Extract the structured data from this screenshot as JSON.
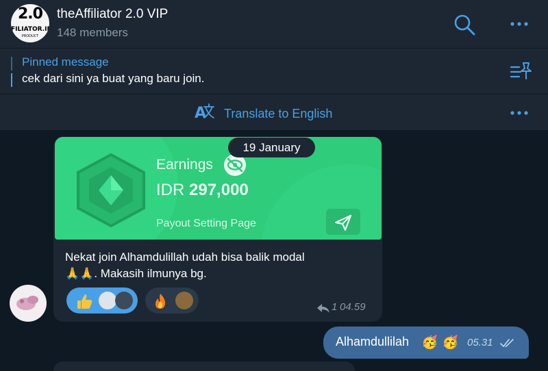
{
  "header": {
    "avatar_big": "2.0",
    "avatar_small": "FILIATOR.ID",
    "avatar_tiny": "PRODUCT",
    "title": "theAffiliator 2.0 VIP",
    "subtitle": "148 members"
  },
  "pinned": {
    "title": "Pinned message",
    "text": "cek dari sini ya buat yang baru join."
  },
  "translate": {
    "label": "Translate to English"
  },
  "message": {
    "date": "19 January",
    "card": {
      "earnings_label": "Earnings",
      "currency": "IDR",
      "amount": "297,000",
      "payout_label": "Payout Setting Page"
    },
    "text_line1": "Nekat join Alhamdulillah udah bisa balik modal",
    "text_line2": "🙏🙏. Makasih ilmunya bg.",
    "reply_count": "1",
    "time": "04.59",
    "reactions": [
      {
        "icon": "thumbs-up"
      },
      {
        "icon": "fire"
      }
    ]
  },
  "outgoing": {
    "text": "Alhamdullilah",
    "emoji": "🥳",
    "time": "05.31"
  },
  "colors": {
    "accent": "#4aa0e6",
    "panel": "#1c2733",
    "background": "#0f1923",
    "card_green": "#2ecc7b",
    "outgoing_bubble": "#3d6a9a"
  }
}
